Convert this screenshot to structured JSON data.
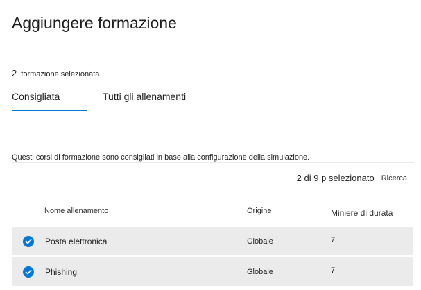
{
  "panel": {
    "title": "Aggiungere formazione",
    "selected_count": "2",
    "selected_label": "formazione selezionata"
  },
  "tabs": [
    {
      "label": "Consigliata",
      "active": true
    },
    {
      "label": "Tutti gli allenamenti",
      "active": false
    }
  ],
  "description": "Questi corsi di formazione sono consigliati in base alla configurazione della simulazione.",
  "toolbar": {
    "selection_counter": "2 di 9 p selezionato",
    "search_label": "Ricerca"
  },
  "table": {
    "columns": [
      "Nome allenamento",
      "Origine",
      "Miniere di durata"
    ],
    "rows": [
      {
        "name": "Posta elettronica",
        "origin": "Globale",
        "duration": "7",
        "selected": true
      },
      {
        "name": "Phishing",
        "origin": "Globale",
        "duration": "7",
        "selected": true
      }
    ]
  },
  "colors": {
    "accent": "#0078d4",
    "row_selected_bg": "#ebebeb"
  }
}
